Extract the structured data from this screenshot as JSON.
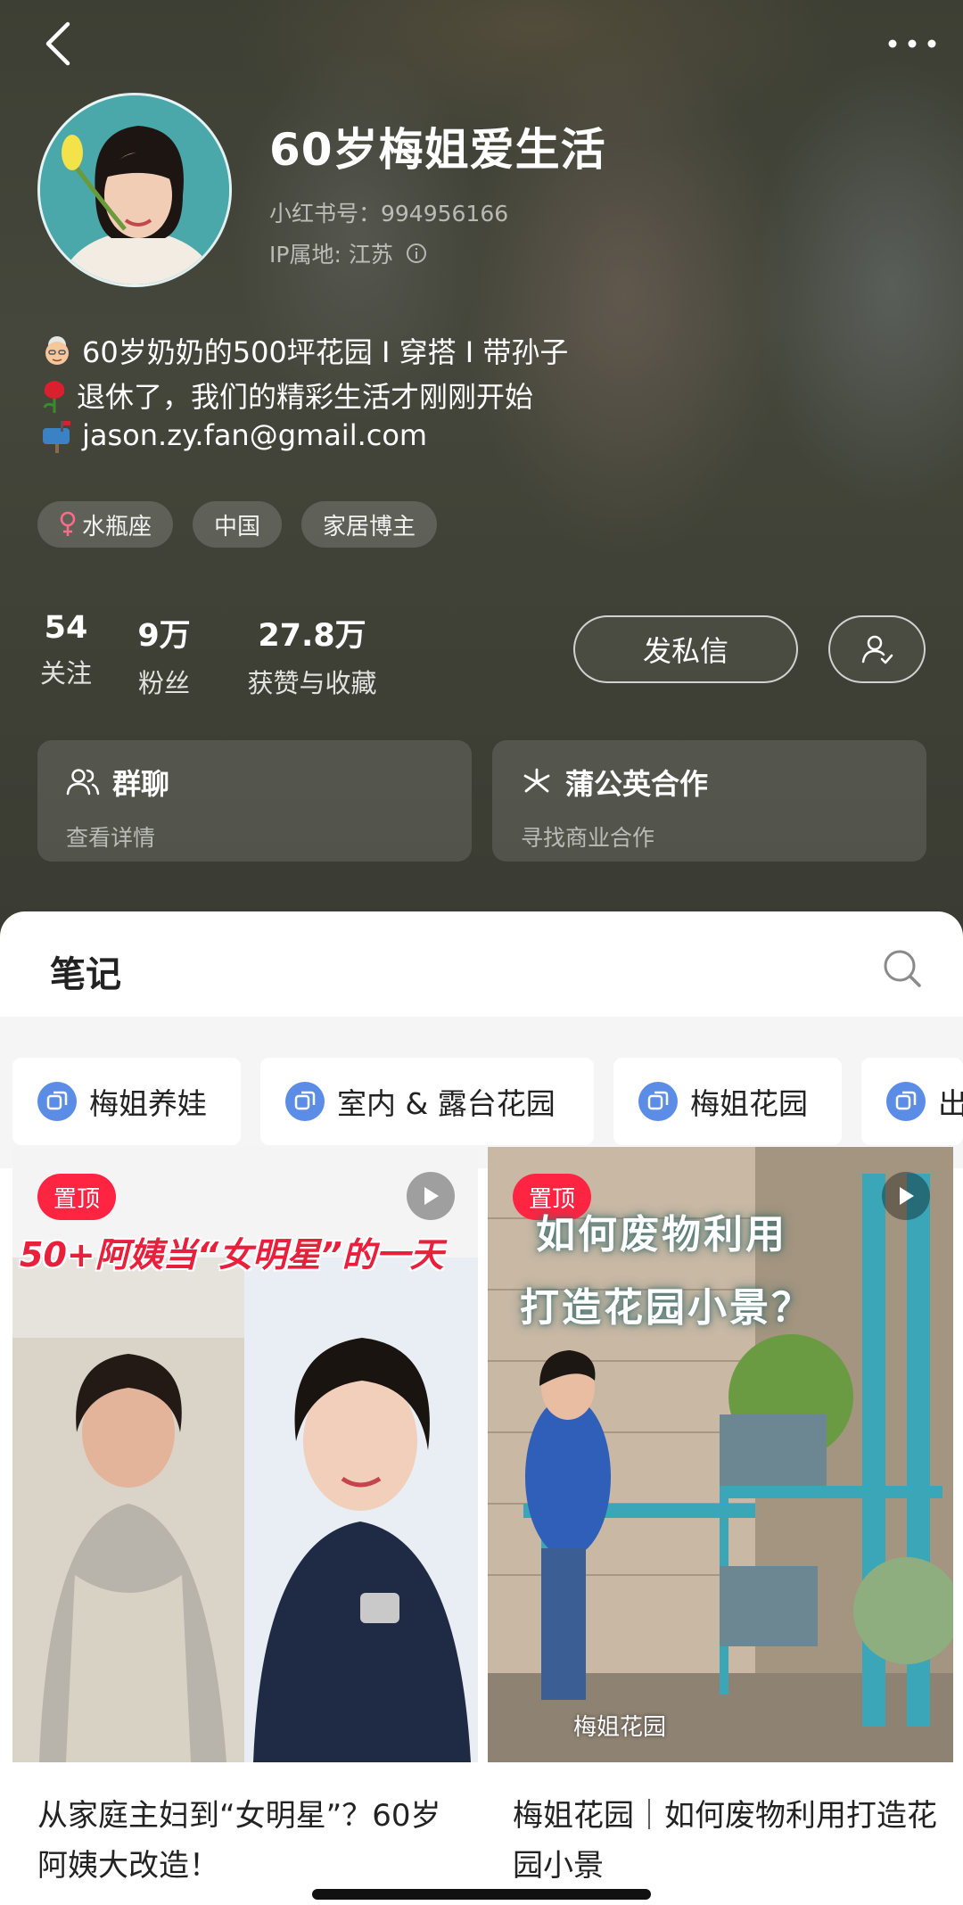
{
  "profile": {
    "name": "60岁梅姐爱生活",
    "id_text": "小红书号：994956166",
    "ip_text": "IP属地: 江苏",
    "bio": [
      "60岁奶奶的500坪花园 I 穿搭 I 带孙子",
      "退休了，我们的精彩生活才刚刚开始",
      "jason.zy.fan@gmail.com"
    ],
    "tags": [
      "水瓶座",
      "中国",
      "家居博主"
    ]
  },
  "stats": [
    {
      "value": "54",
      "label": "关注"
    },
    {
      "value": "9万",
      "label": "粉丝"
    },
    {
      "value": "27.8万",
      "label": "获赞与收藏"
    }
  ],
  "actions": {
    "message_label": "发私信"
  },
  "cards": [
    {
      "title": "群聊",
      "subtitle": "查看详情"
    },
    {
      "title": "蒲公英合作",
      "subtitle": "寻找商业合作"
    }
  ],
  "notes_section": {
    "title": "笔记",
    "collections": [
      "梅姐养娃",
      "室内 & 露台花园",
      "梅姐花园",
      "出"
    ]
  },
  "notes": [
    {
      "badge": "置顶",
      "cover_text": "50+阿姨当“女明星”的一天",
      "title": "从家庭主妇到“女明星”？60岁阿姨大改造！"
    },
    {
      "badge": "置顶",
      "cover_text_1": "如何废物利用",
      "cover_text_2": "打造花园小景？",
      "watermark": "梅姐花园",
      "title": "梅姐花园｜如何废物利用打造花园小景"
    }
  ],
  "colors": {
    "header_bg": "#404237",
    "accent_red": "#ff2442",
    "collection_icon": "#5b8de6"
  },
  "icons": [
    "back-icon",
    "more-icon",
    "info-icon",
    "female-icon",
    "follow-status-icon",
    "group-icon",
    "dandelion-icon",
    "search-icon",
    "collection-icon",
    "play-icon"
  ]
}
